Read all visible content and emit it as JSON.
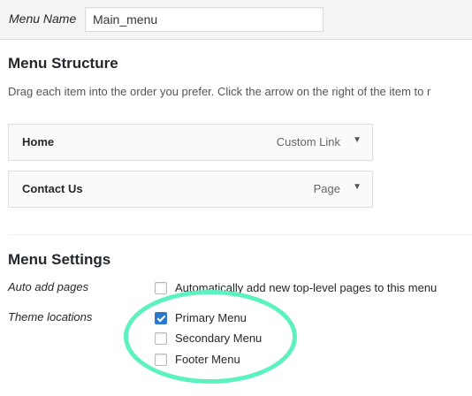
{
  "menu_name": {
    "label": "Menu Name",
    "value": "Main_menu"
  },
  "menu_structure": {
    "title": "Menu Structure",
    "instructions": "Drag each item into the order you prefer. Click the arrow on the right of the item to r",
    "items": [
      {
        "title": "Home",
        "type": "Custom Link"
      },
      {
        "title": "Contact Us",
        "type": "Page"
      }
    ]
  },
  "menu_settings": {
    "title": "Menu Settings",
    "auto_add": {
      "label": "Auto add pages",
      "option": "Automatically add new top-level pages to this menu",
      "checked": false
    },
    "theme_locations": {
      "label": "Theme locations",
      "options": [
        {
          "label": "Primary Menu",
          "checked": true
        },
        {
          "label": "Secondary Menu",
          "checked": false
        },
        {
          "label": "Footer Menu",
          "checked": false
        }
      ]
    }
  },
  "colors": {
    "checkbox_checked": "#2b7bd3",
    "highlight": "#5cf2c0"
  },
  "icons": {
    "item_toggle": "triangle-down"
  }
}
